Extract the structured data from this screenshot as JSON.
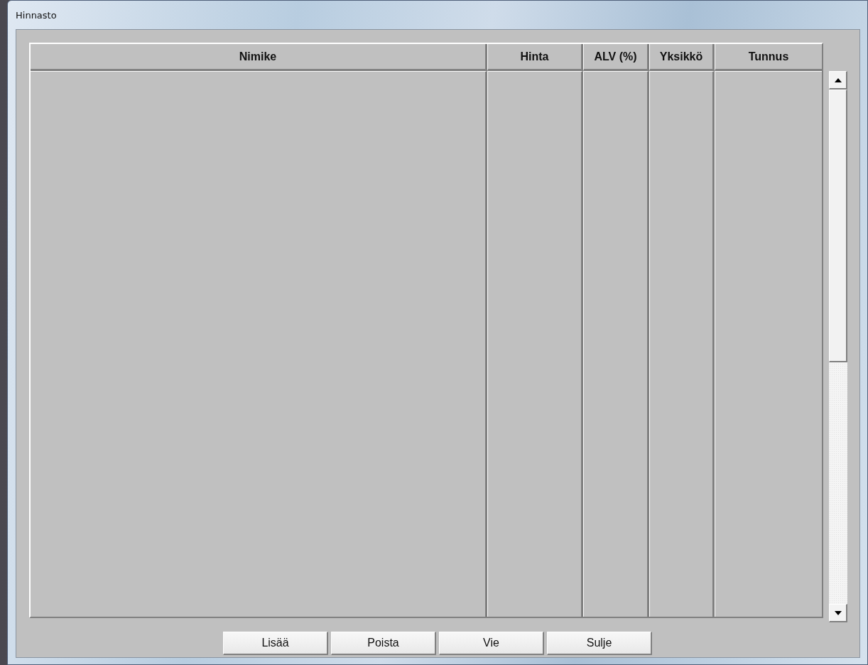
{
  "window": {
    "title": "Hinnasto"
  },
  "table": {
    "columns": [
      "Nimike",
      "Hinta",
      "ALV (%)",
      "Yksikkö",
      "Tunnus"
    ]
  },
  "buttons": [
    "Lisää",
    "Poista",
    "Vie",
    "Sulje"
  ]
}
